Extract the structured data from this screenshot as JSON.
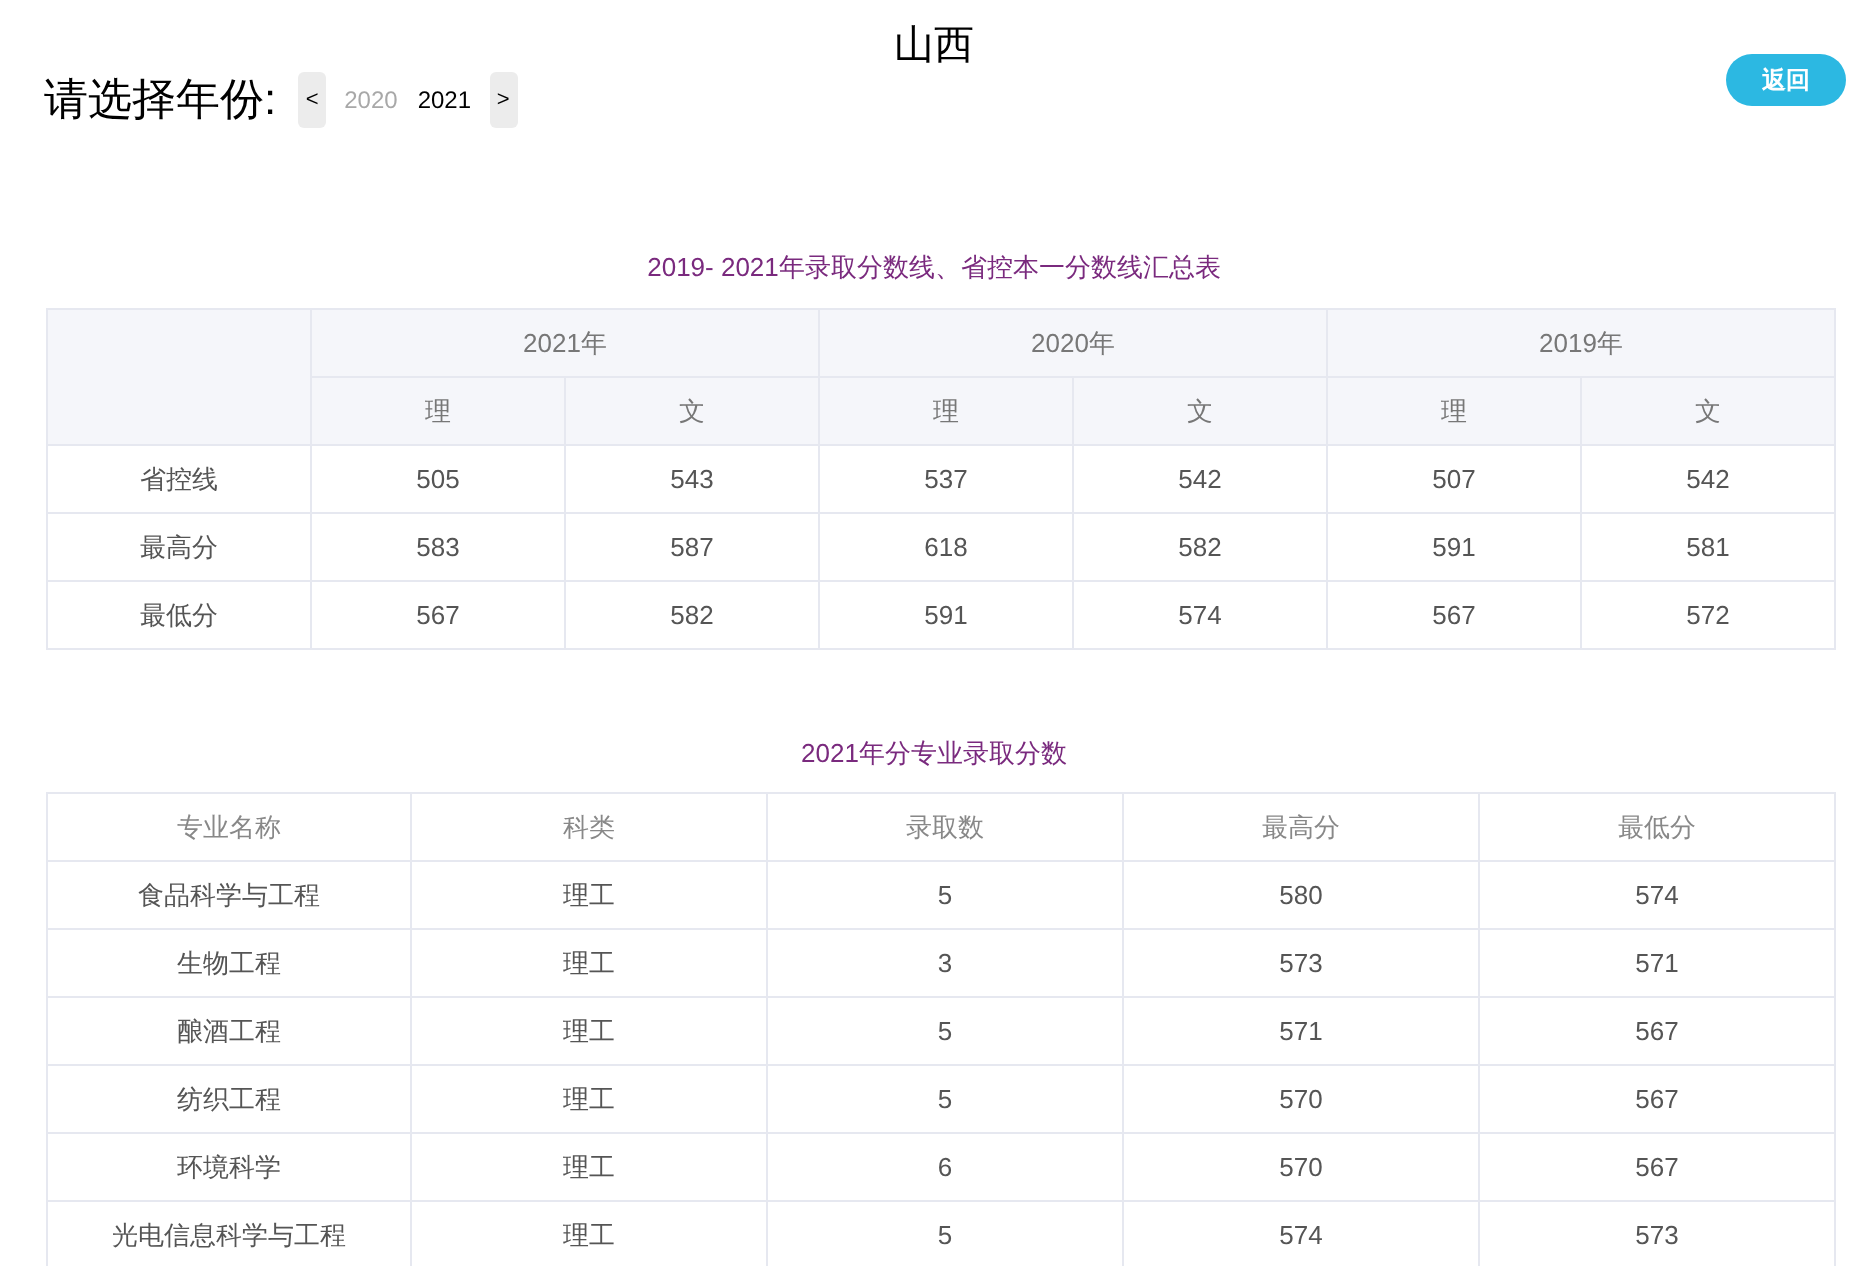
{
  "region_title": "山西",
  "year_picker": {
    "label": "请选择年份:",
    "prev": "<",
    "next": ">",
    "years": [
      {
        "label": "2020",
        "selected": false
      },
      {
        "label": "2021",
        "selected": true
      }
    ]
  },
  "back_button": "返回",
  "summary_table": {
    "caption": "2019- 2021年录取分数线、省控本一分数线汇总表",
    "year_headers": [
      "2021年",
      "2020年",
      "2019年"
    ],
    "sub_headers": [
      "理",
      "文",
      "理",
      "文",
      "理",
      "文"
    ],
    "rows": [
      {
        "label": "省控线",
        "cells": [
          "505",
          "543",
          "537",
          "542",
          "507",
          "542"
        ]
      },
      {
        "label": "最高分",
        "cells": [
          "583",
          "587",
          "618",
          "582",
          "591",
          "581"
        ]
      },
      {
        "label": "最低分",
        "cells": [
          "567",
          "582",
          "591",
          "574",
          "567",
          "572"
        ]
      }
    ]
  },
  "major_table": {
    "caption": "2021年分专业录取分数",
    "columns": [
      "专业名称",
      "科类",
      "录取数",
      "最高分",
      "最低分"
    ],
    "rows": [
      [
        "食品科学与工程",
        "理工",
        "5",
        "580",
        "574"
      ],
      [
        "生物工程",
        "理工",
        "3",
        "573",
        "571"
      ],
      [
        "酿酒工程",
        "理工",
        "5",
        "571",
        "567"
      ],
      [
        "纺织工程",
        "理工",
        "5",
        "570",
        "567"
      ],
      [
        "环境科学",
        "理工",
        "6",
        "570",
        "567"
      ],
      [
        "光电信息科学与工程",
        "理工",
        "5",
        "574",
        "573"
      ]
    ]
  }
}
